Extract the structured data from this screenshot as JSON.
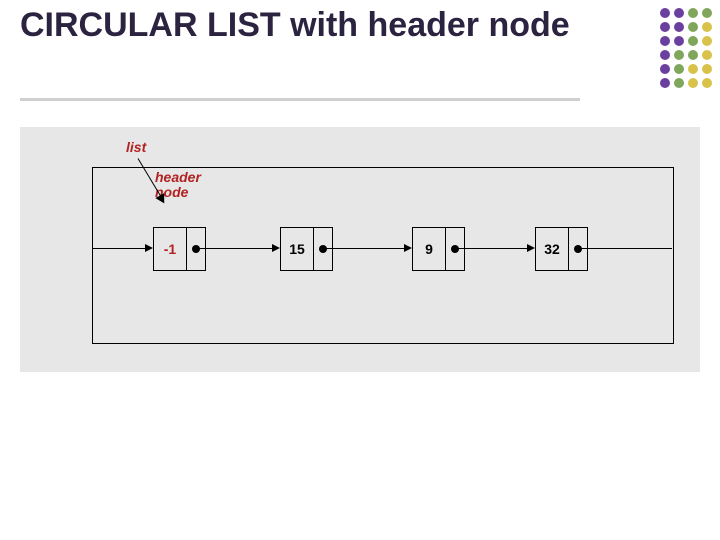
{
  "title": "CIRCULAR LIST with header node",
  "labels": {
    "list": "list",
    "header_node": "header\nnode"
  },
  "nodes": [
    {
      "value": "-1",
      "is_header": true
    },
    {
      "value": "15",
      "is_header": false
    },
    {
      "value": "9",
      "is_header": false
    },
    {
      "value": "32",
      "is_header": false
    }
  ],
  "deco": {
    "colors": [
      "#6a3fa0",
      "#7fa65a",
      "#d8c24a"
    ],
    "rows": 6
  }
}
